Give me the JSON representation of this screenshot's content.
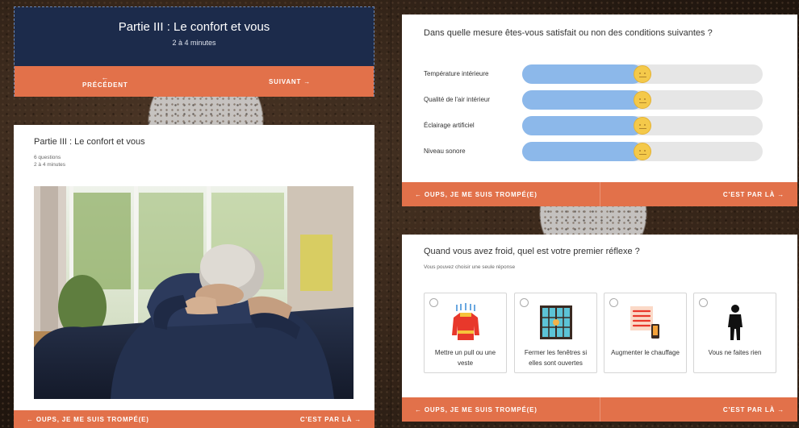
{
  "intro": {
    "title": "Partie III : Le confort et vous",
    "duration": "2 à 4 minutes",
    "prev_label": "PRÉCÉDENT",
    "next_label": "SUIVANT →"
  },
  "part": {
    "title": "Partie III : Le confort et vous",
    "questions": "6 questions",
    "duration": "2 à 4 minutes",
    "back_label": "← OUPS, JE ME SUIS TROMPÉ(E)",
    "next_label": "C'EST PAR LÀ →"
  },
  "satisfaction": {
    "question": "Dans quelle mesure êtes-vous satisfait ou non des conditions suivantes ?",
    "rows": [
      {
        "label": "Température intérieure",
        "value": 0.5
      },
      {
        "label": "Qualité de l'air intérieur",
        "value": 0.5
      },
      {
        "label": "Éclairage artificiel",
        "value": 0.5
      },
      {
        "label": "Niveau sonore",
        "value": 0.5
      }
    ],
    "back_label": "← OUPS, JE ME SUIS TROMPÉ(E)",
    "next_label": "C'EST PAR LÀ →"
  },
  "cold": {
    "question": "Quand vous avez froid, quel est votre premier réflexe ?",
    "hint": "Vous pouvez choisir une seule réponse",
    "options": [
      {
        "label": "Mettre un pull ou une veste",
        "icon": "sweater-icon"
      },
      {
        "label": "Fermer les fenêtres si elles sont ouvertes",
        "icon": "window-icon"
      },
      {
        "label": "Augmenter le chauffage",
        "icon": "radiator-icon"
      },
      {
        "label": "Vous ne faites rien",
        "icon": "person-icon"
      }
    ],
    "back_label": "← OUPS, JE ME SUIS TROMPÉ(E)",
    "next_label": "C'EST PAR LÀ →"
  },
  "colors": {
    "accent": "#e2714a",
    "header": "#1c2b4b",
    "slider_fill": "#8cb8ea",
    "slider_track": "#e6e6e6",
    "thumb": "#f4c94a"
  }
}
